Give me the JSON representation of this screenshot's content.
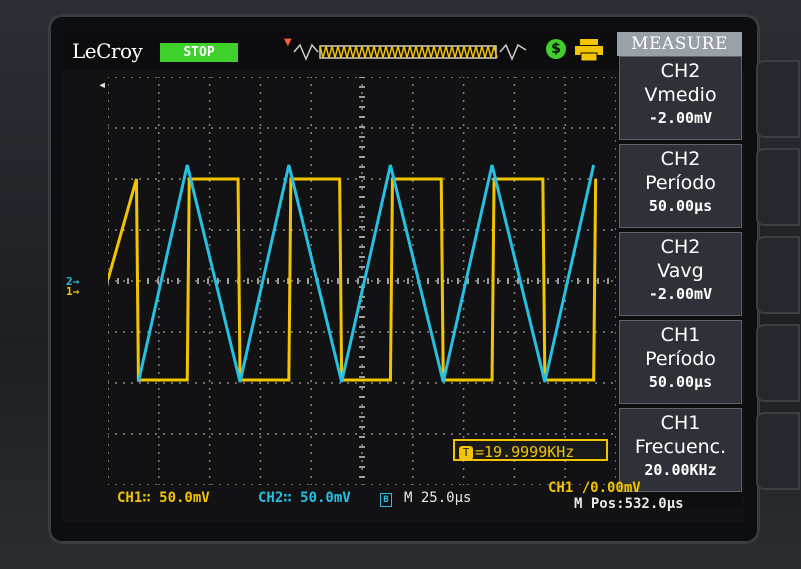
{
  "header": {
    "brand": "LeCroy",
    "run_state": "STOP",
    "trigger_marker": "T",
    "measure_title": "MEASURE"
  },
  "icons": [
    "arrow-left-icon",
    "trigger-position-icon",
    "usb-icon",
    "printer-icon"
  ],
  "colors": {
    "ch1": "#f2c500",
    "ch2": "#27c0e0",
    "run": "#3fd02c"
  },
  "measurements": [
    {
      "channel": "CH2",
      "name": "Vmedio",
      "value": "-2.00mV"
    },
    {
      "channel": "CH2",
      "name": "Período",
      "value": "50.00μs"
    },
    {
      "channel": "CH2",
      "name": "Vavg",
      "value": "-2.00mV"
    },
    {
      "channel": "CH1",
      "name": "Período",
      "value": "50.00μs"
    },
    {
      "channel": "CH1",
      "name": "Frecuenc.",
      "value": "20.00KHz"
    }
  ],
  "frequency_counter": "=19.9999KHz",
  "status": {
    "ch1_scale": "CH1∷ 50.0mV",
    "ch2_scale": "CH2∷ 50.0mV",
    "bw_limit": "B",
    "timebase": "M 25.0μs",
    "trigger": "CH1 /0.00mV",
    "position": "M Pos:532.0μs"
  },
  "channel_markers": {
    "ch2": "2→",
    "ch1": "1→"
  },
  "waveforms": {
    "ch1": {
      "type": "square",
      "periods_visible": 5
    },
    "ch2": {
      "type": "triangle",
      "periods_visible": 5
    }
  }
}
